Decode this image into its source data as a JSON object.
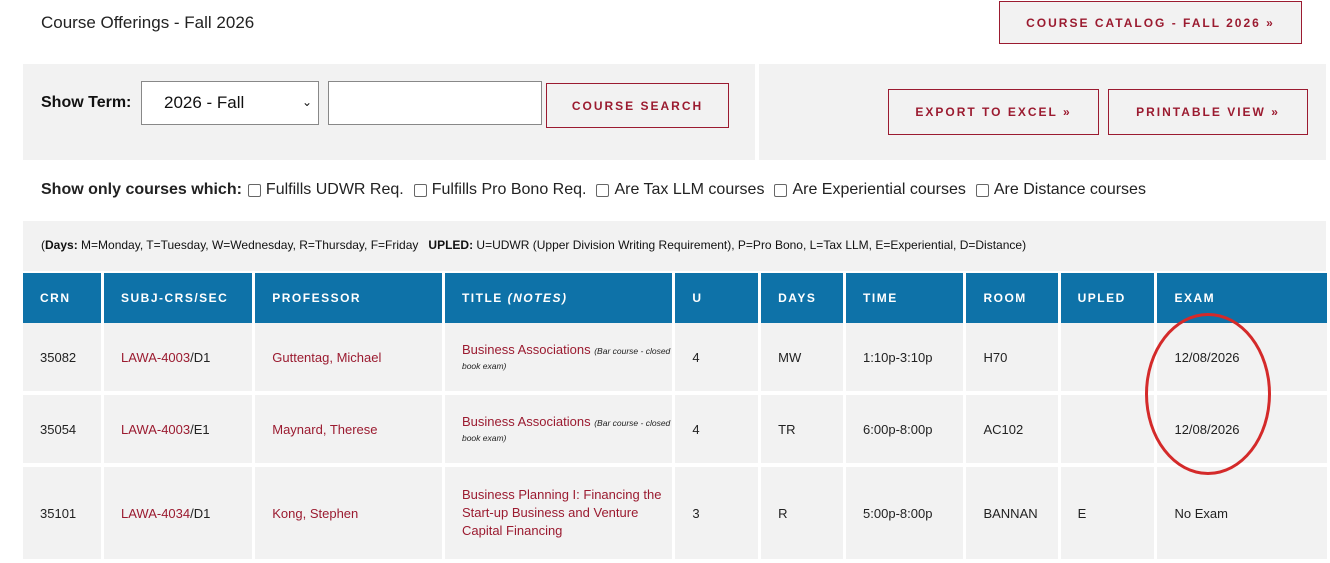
{
  "page_title": "Course Offerings  -  Fall 2026",
  "catalog_button": "COURSE CATALOG - FALL 2026 »",
  "term": {
    "label": "Show Term:",
    "selected": "2026 - Fall"
  },
  "search": {
    "value": "",
    "button": "COURSE SEARCH"
  },
  "export_button": "EXPORT TO EXCEL »",
  "printable_button": "PRINTABLE VIEW »",
  "filters": {
    "label": "Show only courses which:",
    "options": [
      "Fulfills UDWR Req.",
      "Fulfills Pro Bono Req.",
      "Are Tax LLM courses",
      "Are Experiential courses",
      "Are Distance courses"
    ]
  },
  "legend": {
    "open": "(",
    "days_label": "Days:",
    "days_text": " M=Monday, T=Tuesday, W=Wednesday, R=Thursday, F=Friday",
    "upled_label": "UPLED:",
    "upled_text": " U=UDWR (Upper Division Writing Requirement), P=Pro Bono, L=Tax LLM, E=Experiential, D=Distance)"
  },
  "table": {
    "headers": [
      "CRN",
      "SUBJ-CRS/SEC",
      "PROFESSOR",
      "TITLE",
      "U",
      "DAYS",
      "TIME",
      "ROOM",
      "UPLED",
      "EXAM"
    ],
    "title_header_notes": "(NOTES)",
    "rows": [
      {
        "crn": "35082",
        "course": "LAWA-4003",
        "sec": "/D1",
        "professor": "Guttentag, Michael",
        "title": "Business Associations",
        "note": "(Bar course - closed book exam)",
        "units": "4",
        "days": "MW",
        "time": "1:10p-3:10p",
        "room": "H70",
        "upled": "",
        "exam": "12/08/2026"
      },
      {
        "crn": "35054",
        "course": "LAWA-4003",
        "sec": "/E1",
        "professor": "Maynard, Therese",
        "title": "Business Associations",
        "note": "(Bar course - closed book exam)",
        "units": "4",
        "days": "TR",
        "time": "6:00p-8:00p",
        "room": "AC102",
        "upled": "",
        "exam": "12/08/2026"
      },
      {
        "crn": "35101",
        "course": "LAWA-4034",
        "sec": "/D1",
        "professor": "Kong, Stephen",
        "title": "Business Planning I: Financing the Start-up Business and Venture Capital Financing",
        "note": "",
        "units": "3",
        "days": "R",
        "time": "5:00p-8:00p",
        "room": "BANNAN",
        "upled": "E",
        "exam": "No Exam"
      }
    ]
  },
  "colors": {
    "accent": "#9b1b30",
    "header_bg": "#0e72a8",
    "panel_bg": "#f2f2f2",
    "annotation": "#d42a2a"
  }
}
